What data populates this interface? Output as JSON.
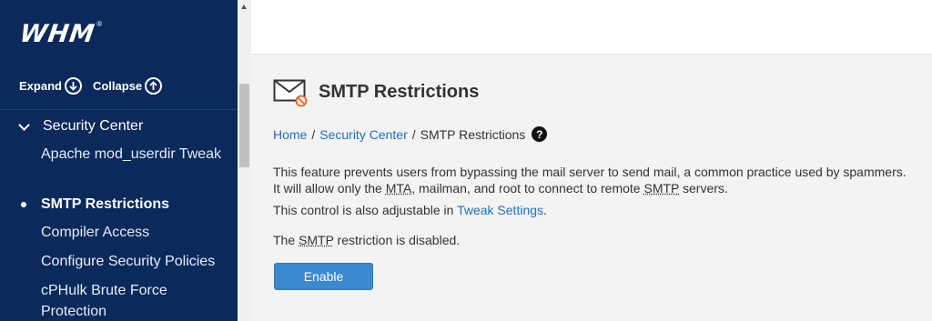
{
  "sidebar": {
    "logo": "WHM",
    "logo_reg": "®",
    "expand_label": "Expand",
    "collapse_label": "Collapse",
    "section_label": "Security Center",
    "items": [
      {
        "label": "Apache mod_userdir Tweak"
      },
      {
        "label": "SMTP Restrictions"
      },
      {
        "label": "Compiler Access"
      },
      {
        "label": "Configure Security Policies"
      },
      {
        "label": "cPHulk Brute Force Protection"
      }
    ]
  },
  "page": {
    "title": "SMTP Restrictions",
    "breadcrumb": {
      "home": "Home",
      "section": "Security Center",
      "current": "SMTP Restrictions",
      "sep": "/"
    },
    "desc_1a": "This feature prevents users from bypassing the mail server to send mail, a common practice used by spammers.",
    "desc_1b_pre": "It will allow only the ",
    "mta": "MTA",
    "desc_1b_mid": ", mailman, and root to connect to remote ",
    "smtp": "SMTP",
    "desc_1b_post": " servers.",
    "desc_2_pre": "This control is also adjustable in ",
    "tweak_link": "Tweak Settings",
    "desc_2_post": ".",
    "status_pre": "The ",
    "status_post": " restriction is disabled.",
    "enable_button": "Enable"
  }
}
